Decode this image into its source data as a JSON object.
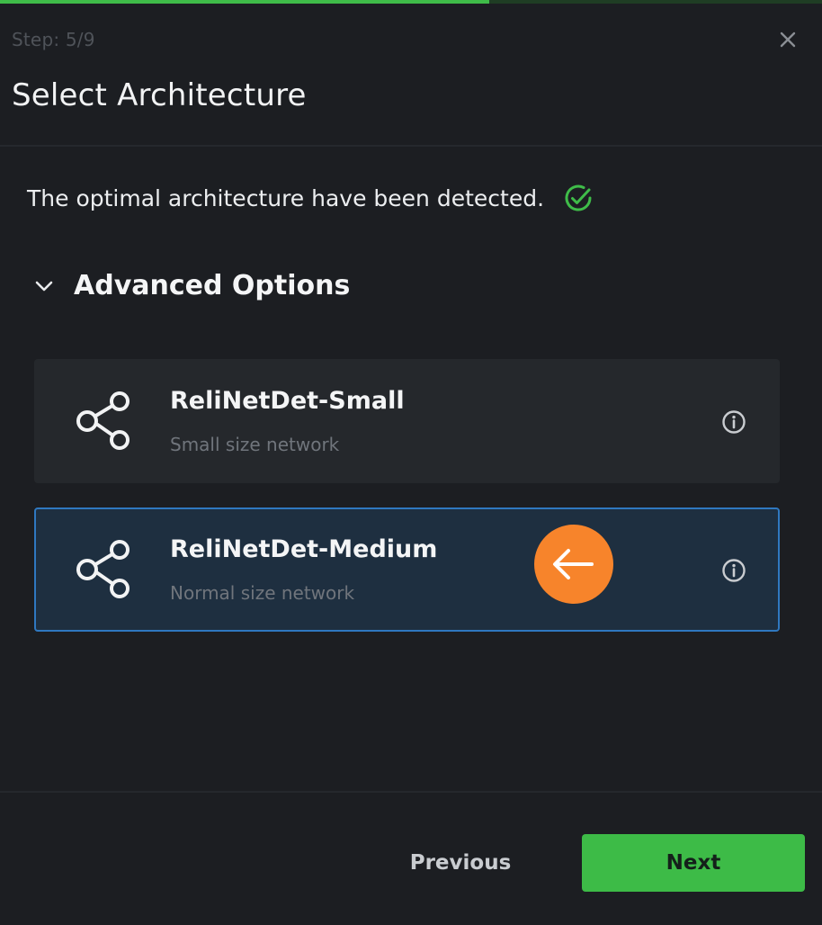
{
  "progress": {
    "current_step": 5,
    "total_steps": 9,
    "fill_fraction": 0.595,
    "track_color": "#1f3d24",
    "fill_color": "#3fbc49"
  },
  "header": {
    "step_label": "Step: 5/9",
    "title": "Select Architecture",
    "close_icon": "close-icon"
  },
  "detection": {
    "message": "The optimal architecture have been detected.",
    "status_icon": "check-circle-icon",
    "status_color": "#3fbc49"
  },
  "advanced": {
    "label": "Advanced Options",
    "expanded": true,
    "toggle_icon": "chevron-down-icon"
  },
  "architectures": [
    {
      "title": "ReliNetDet-Small",
      "subtitle": "Small size network",
      "icon": "share-icon",
      "info_icon": "info-icon",
      "selected": false
    },
    {
      "title": "ReliNetDet-Medium",
      "subtitle": "Normal size network",
      "icon": "share-icon",
      "info_icon": "info-icon",
      "selected": true
    }
  ],
  "pointer": {
    "icon": "arrow-left-icon",
    "color": "#f7842b"
  },
  "footer": {
    "previous_label": "Previous",
    "next_label": "Next",
    "accent_color": "#3dbb47"
  },
  "colors": {
    "background": "#1c1e22",
    "card": "#25282c",
    "selected_card": "#1e2f40",
    "selected_border": "#2f78c0"
  }
}
